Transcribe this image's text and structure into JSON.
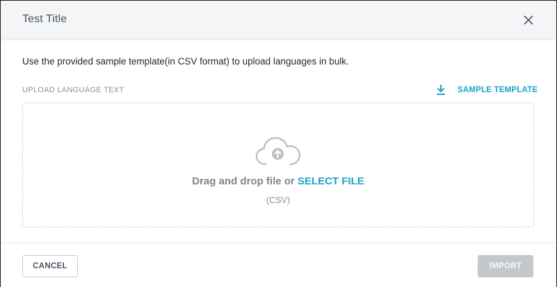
{
  "modal": {
    "title": "Test Title",
    "close_icon": "close-icon"
  },
  "body": {
    "instructions": "Use the provided sample template(in CSV format) to upload languages in bulk.",
    "upload_label": "UPLOAD LANGUAGE TEXT",
    "sample_template": {
      "icon": "download-icon",
      "label": "SAMPLE TEMPLATE"
    },
    "dropzone": {
      "icon": "cloud-upload-icon",
      "drag_text": "Drag and drop file or",
      "select_file_label": "SELECT FILE",
      "format_hint": "(CSV)"
    }
  },
  "footer": {
    "cancel_label": "CANCEL",
    "import_label": "IMPORT",
    "import_disabled": true
  },
  "colors": {
    "accent": "#1aa3c8",
    "header_bg": "#f4f5f7",
    "disabled_button": "#c3c8cd",
    "title_text": "#4a5562"
  }
}
